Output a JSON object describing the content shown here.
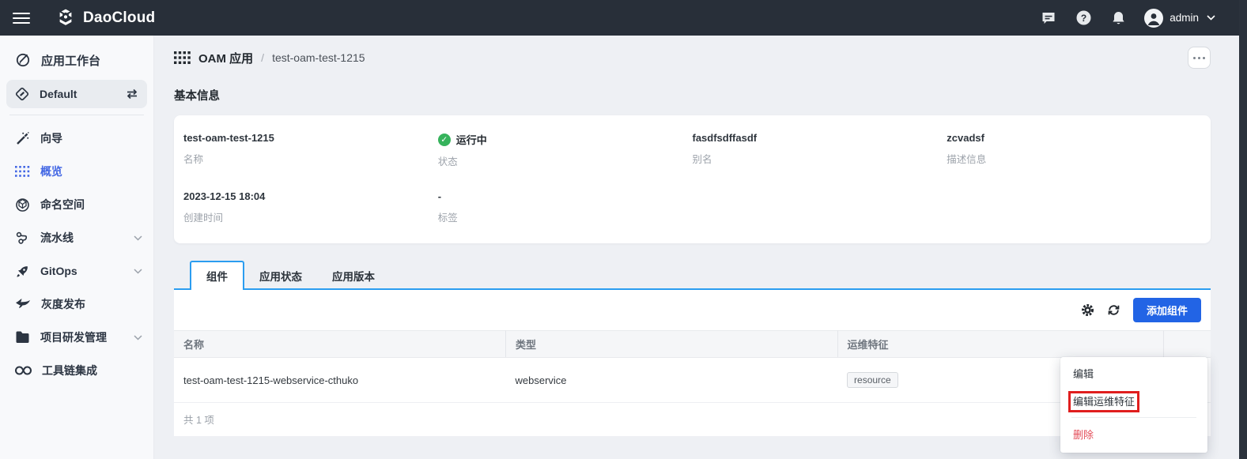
{
  "header": {
    "brand": "DaoCloud",
    "user": "admin",
    "icons": [
      "chat-icon",
      "help-icon",
      "bell-icon",
      "avatar-icon",
      "chevron-down-icon"
    ]
  },
  "sidebar": {
    "items": [
      {
        "label": "应用工作台",
        "icon": "workbench-icon"
      },
      {
        "label": "Default",
        "icon": "workspace-icon",
        "trailing_icon": "switch-workspace-icon",
        "selected": true
      },
      {
        "label": "向导",
        "icon": "wand-icon"
      },
      {
        "label": "概览",
        "icon": "grid-dots-icon",
        "active": true
      },
      {
        "label": "命名空间",
        "icon": "namespace-cube-icon"
      },
      {
        "label": "流水线",
        "icon": "pipeline-icon",
        "expandable": true
      },
      {
        "label": "GitOps",
        "icon": "rocket-icon",
        "expandable": true
      },
      {
        "label": "灰度发布",
        "icon": "bird-icon"
      },
      {
        "label": "项目研发管理",
        "icon": "folder-icon",
        "expandable": true
      },
      {
        "label": "工具链集成",
        "icon": "infinity-icon"
      }
    ]
  },
  "breadcrumb": {
    "root": "OAM 应用",
    "separator": "/",
    "current": "test-oam-test-1215"
  },
  "basic_info": {
    "title": "基本信息",
    "fields": [
      {
        "value": "test-oam-test-1215",
        "label": "名称"
      },
      {
        "value": "运行中",
        "label": "状态",
        "status": "success"
      },
      {
        "value": "fasdfsdffasdf",
        "label": "别名"
      },
      {
        "value": "zcvadsf",
        "label": "描述信息"
      },
      {
        "value": "2023-12-15 18:04",
        "label": "创建时间"
      },
      {
        "value": "-",
        "label": "标签"
      }
    ]
  },
  "tabs": [
    {
      "label": "组件",
      "active": true
    },
    {
      "label": "应用状态",
      "active": false
    },
    {
      "label": "应用版本",
      "active": false
    }
  ],
  "toolbar": {
    "add_button": "添加组件",
    "icons": [
      "gear-icon",
      "refresh-icon"
    ]
  },
  "table": {
    "columns": [
      "名称",
      "类型",
      "运维特征"
    ],
    "rows": [
      {
        "name": "test-oam-test-1215-webservice-cthuko",
        "type": "webservice",
        "traits": [
          "resource"
        ],
        "trait_chip": "resource"
      }
    ],
    "footer": "共 1 项"
  },
  "context_menu": {
    "items": [
      {
        "label": "编辑"
      },
      {
        "label": "编辑运维特征",
        "annotated": true
      },
      {
        "label": "删除",
        "danger": true
      }
    ]
  },
  "colors": {
    "topbar_bg": "#282f39",
    "accent_blue": "#2264e5",
    "tab_blue": "#2b9df0",
    "sidebar_active_blue": "#4468e4",
    "success_green": "#36b35c",
    "danger_red": "#e34d59",
    "annotation_red": "#e01e1e"
  }
}
